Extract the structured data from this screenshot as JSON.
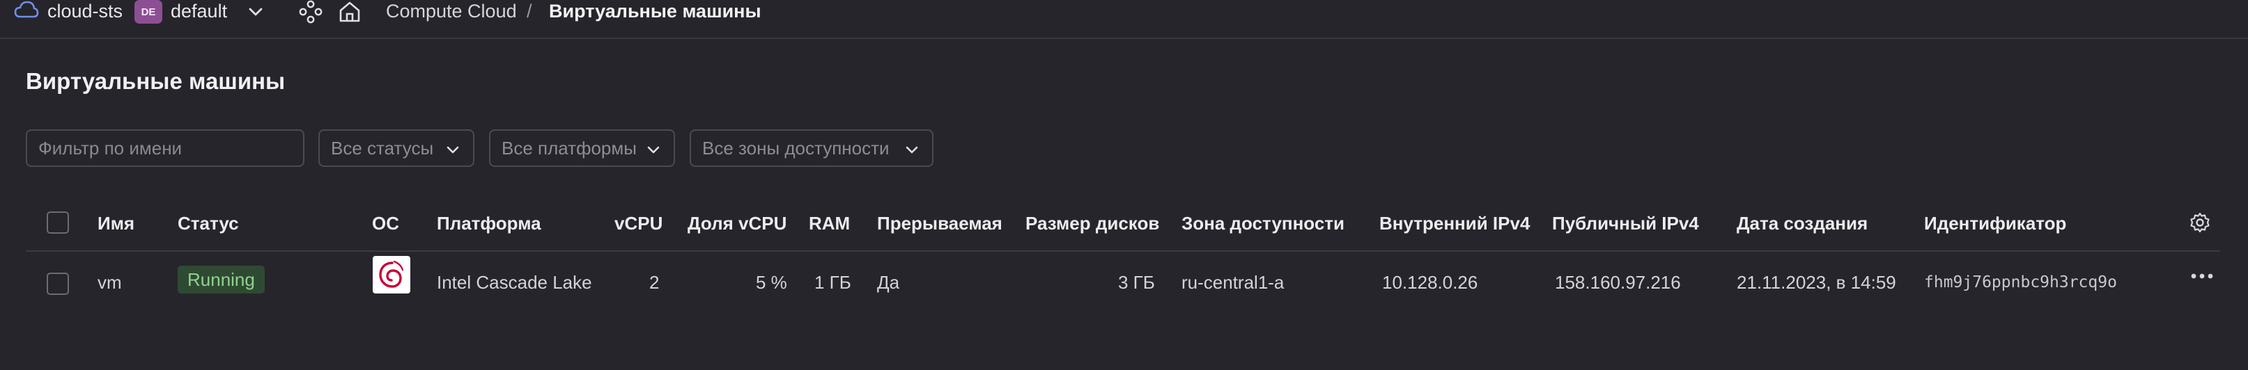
{
  "header": {
    "cloud_name": "cloud-sts",
    "folder_badge": "DE",
    "folder_name": "default",
    "breadcrumb": [
      "Compute Cloud",
      "/",
      "Виртуальные машины"
    ]
  },
  "page": {
    "title": "Виртуальные машины"
  },
  "filters": {
    "search_placeholder": "Фильтр по имени",
    "status": "Все статусы",
    "platform": "Все платформы",
    "zone": "Все зоны доступности"
  },
  "table": {
    "columns": [
      "Имя",
      "Статус",
      "ОС",
      "Платформа",
      "vCPU",
      "Доля vCPU",
      "RAM",
      "Прерываемая",
      "Размер дисков",
      "Зона доступности",
      "Внутренний IPv4",
      "Публичный IPv4",
      "Дата создания",
      "Идентификатор"
    ],
    "rows": [
      {
        "name": "vm",
        "status": "Running",
        "os_icon": "debian-logo",
        "platform": "Intel Cascade Lake",
        "vcpu": "2",
        "vcpu_share": "5 %",
        "ram": "1 ГБ",
        "preemptible": "Да",
        "disk_size": "3 ГБ",
        "zone": "ru-central1-a",
        "internal_ipv4": "10.128.0.26",
        "public_ipv4": "158.160.97.216",
        "created": "21.11.2023, в 14:59",
        "id": "fhm9j76ppnbc9h3rcq9o"
      }
    ]
  },
  "colors": {
    "background": "#26252b",
    "badge_running_bg": "#2f4a32",
    "badge_running_text": "#8fd28f",
    "folder_badge_bg": "#8d4f93",
    "cloud_icon": "#6f8fe8",
    "debian_red": "#c70036"
  }
}
